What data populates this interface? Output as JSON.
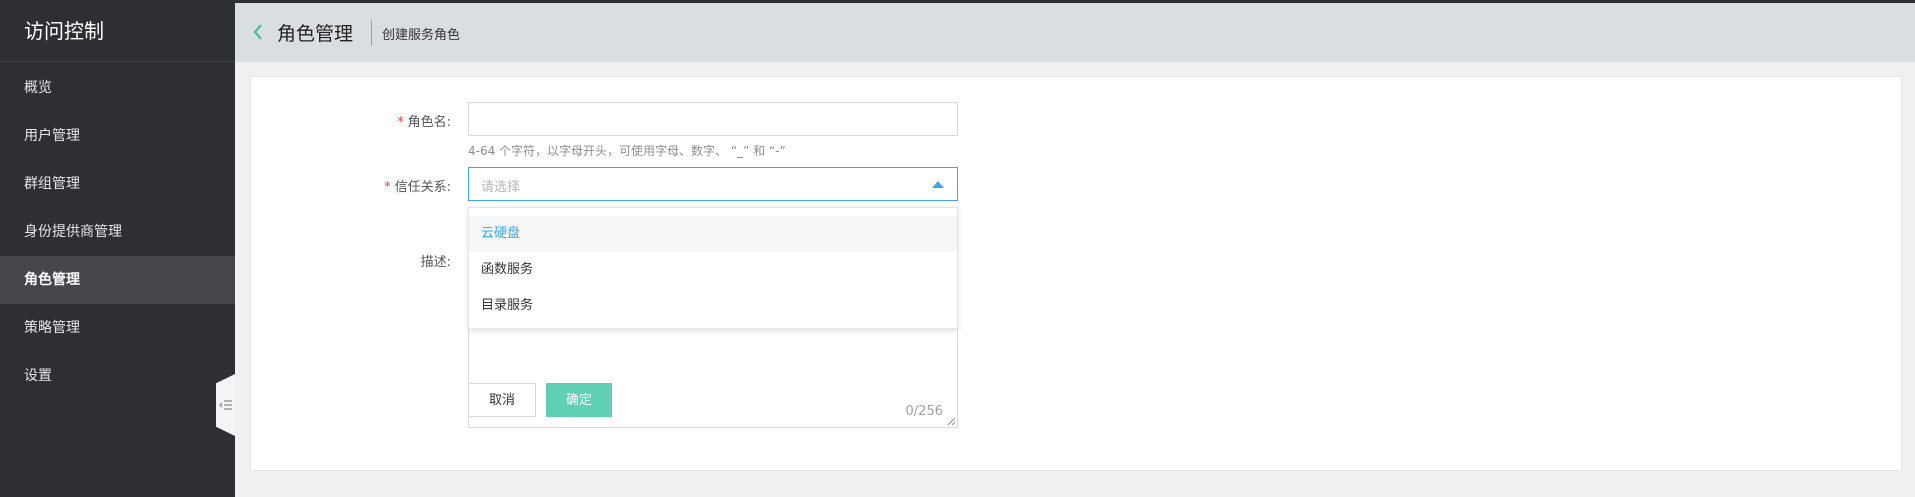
{
  "sidebar": {
    "title": "访问控制",
    "items": [
      {
        "label": "概览",
        "active": false
      },
      {
        "label": "用户管理",
        "active": false
      },
      {
        "label": "群组管理",
        "active": false
      },
      {
        "label": "身份提供商管理",
        "active": false
      },
      {
        "label": "角色管理",
        "active": true
      },
      {
        "label": "策略管理",
        "active": false
      },
      {
        "label": "设置",
        "active": false
      }
    ],
    "collapse_icon": "collapse-menu-icon"
  },
  "header": {
    "back_icon": "chevron-left-icon",
    "title": "角色管理",
    "subtitle": "创建服务角色"
  },
  "form": {
    "role_name": {
      "label": "角色名:",
      "value": "",
      "hint": "4-64 个字符，以字母开头，可使用字母、数字、 “_” 和 “-”"
    },
    "trust": {
      "label": "信任关系:",
      "placeholder": "请选择",
      "open": true
    },
    "description": {
      "label": "描述:",
      "value": "",
      "counter": "0/256"
    },
    "required_mark": "*"
  },
  "dropdown": {
    "options": [
      "云硬盘",
      "函数服务",
      "目录服务"
    ],
    "hovered_index": 0
  },
  "buttons": {
    "cancel": "取消",
    "ok": "确定"
  },
  "colors": {
    "sidebar_bg": "#2d2f33",
    "accent": "#3fa7e8",
    "primary_button": "#5fd0b1",
    "required": "#e84545"
  }
}
